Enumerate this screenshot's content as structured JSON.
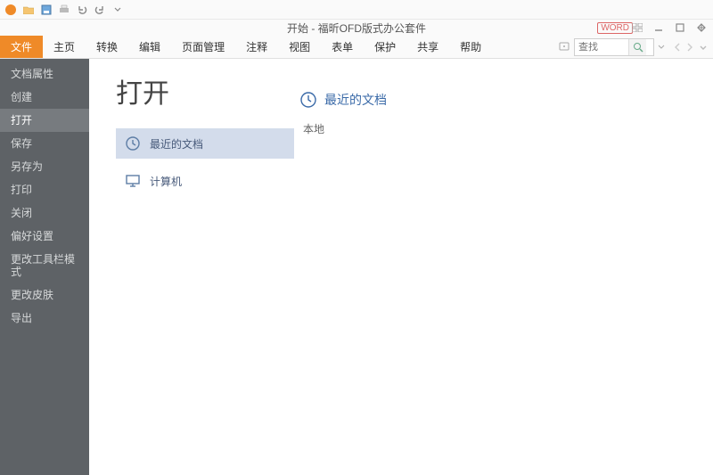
{
  "app": {
    "title": "开始 - 福昕OFD版式办公套件",
    "word_badge": "WORD"
  },
  "ribbon": {
    "file": "文件",
    "tabs": [
      "主页",
      "转换",
      "编辑",
      "页面管理",
      "注释",
      "视图",
      "表单",
      "保护",
      "共享",
      "帮助"
    ],
    "search_placeholder": "查找"
  },
  "sidebar": {
    "items": [
      {
        "label": "文档属性",
        "active": false
      },
      {
        "label": "创建",
        "active": false
      },
      {
        "label": "打开",
        "active": true
      },
      {
        "label": "保存",
        "active": false
      },
      {
        "label": "另存为",
        "active": false
      },
      {
        "label": "打印",
        "active": false
      },
      {
        "label": "关闭",
        "active": false
      },
      {
        "label": "偏好设置",
        "active": false
      },
      {
        "label": "更改工具栏模式",
        "active": false
      },
      {
        "label": "更改皮肤",
        "active": false
      },
      {
        "label": "导出",
        "active": false
      }
    ]
  },
  "main": {
    "heading": "打开",
    "sources": [
      {
        "label": "最近的文档",
        "active": true
      },
      {
        "label": "计算机",
        "active": false
      }
    ],
    "right_title": "最近的文档",
    "right_subhead": "本地"
  },
  "colors": {
    "accent": "#ef8a28",
    "sidebar_bg": "#5e6266",
    "link_blue": "#3a6aa8",
    "selection": "#d3dceb"
  }
}
